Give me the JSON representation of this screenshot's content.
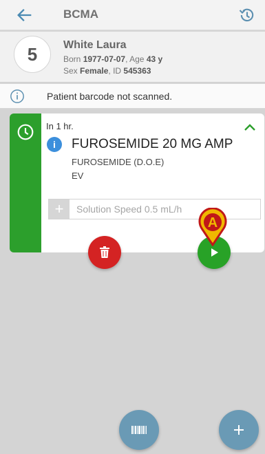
{
  "appbar": {
    "title": "BCMA"
  },
  "patient": {
    "bed": "5",
    "name": "White Laura",
    "born_label": "Born",
    "born": "1977-07-07",
    "age_label": "Age",
    "age": "43 y",
    "sex_label": "Sex",
    "sex": "Female",
    "id_label": "ID",
    "id": "545363"
  },
  "warning": {
    "text": "Patient barcode not scanned."
  },
  "card": {
    "when": "In 1 hr.",
    "drug": "FUROSEMIDE 20 MG AMP",
    "generic": "FUROSEMIDE (D.O.E)",
    "route": "EV",
    "speed_text": "Solution Speed 0.5 mL/h",
    "accent_color": "#2c9f2c"
  },
  "marker": {
    "letter": "A"
  },
  "icons": [
    "back-arrow-icon",
    "history-icon",
    "info-outline-icon",
    "clock-icon",
    "chevron-up-icon",
    "info-icon",
    "plus-icon",
    "trash-icon",
    "play-icon",
    "barcode-icon",
    "add-icon"
  ]
}
